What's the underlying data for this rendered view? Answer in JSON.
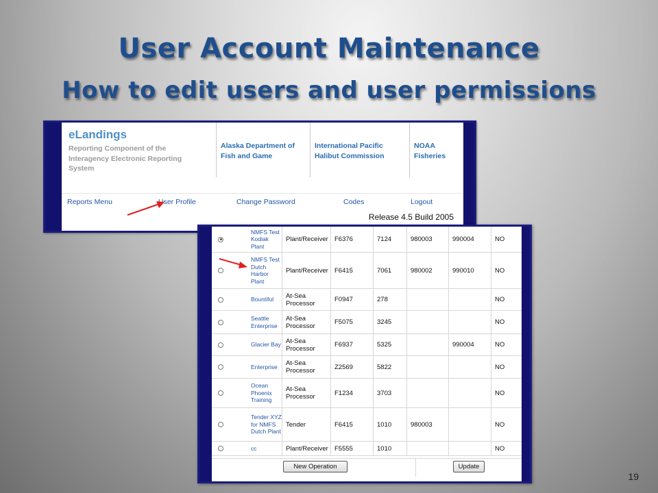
{
  "slide": {
    "title": "User Account Maintenance",
    "subtitle": "How to edit users and user permissions",
    "page_number": "19"
  },
  "elandings_header": {
    "app_name": "eLandings",
    "app_description": "Reporting Component of the Interagency Electronic Reporting System",
    "agencies": [
      "Alaska Department of Fish and Game",
      "International Pacific Halibut Commission",
      "NOAA Fisheries"
    ],
    "nav": [
      "Reports Menu",
      "User Profile",
      "Change Password",
      "Codes",
      "Logout"
    ],
    "release": "Release 4.5 Build 2005"
  },
  "operations_table": {
    "rows": [
      {
        "selected": true,
        "name": "NMFS Test Kodiak Plant",
        "type": "Plant/Receiver",
        "fed": "F6376",
        "code": "7124",
        "p1": "980003",
        "p2": "990004",
        "flag": "NO"
      },
      {
        "selected": false,
        "name": "NMFS Test Dutch Harbor Plant",
        "type": "Plant/Receiver",
        "fed": "F6415",
        "code": "7061",
        "p1": "980002",
        "p2": "990010",
        "flag": "NO"
      },
      {
        "selected": false,
        "name": "Bountiful",
        "type": "At-Sea Processor",
        "fed": "F0947",
        "code": "278",
        "p1": "",
        "p2": "",
        "flag": "NO"
      },
      {
        "selected": false,
        "name": "Seattle Enterprise",
        "type": "At-Sea Processor",
        "fed": "F5075",
        "code": "3245",
        "p1": "",
        "p2": "",
        "flag": "NO"
      },
      {
        "selected": false,
        "name": "Glacier Bay",
        "type": "At-Sea Processor",
        "fed": "F6937",
        "code": "5325",
        "p1": "",
        "p2": "990004",
        "flag": "NO"
      },
      {
        "selected": false,
        "name": "Enterprise",
        "type": "At-Sea Processor",
        "fed": "Z2569",
        "code": "5822",
        "p1": "",
        "p2": "",
        "flag": "NO"
      },
      {
        "selected": false,
        "name": "Ocean Phoenix Training",
        "type": "At-Sea Processor",
        "fed": "F1234",
        "code": "3703",
        "p1": "",
        "p2": "",
        "flag": "NO"
      },
      {
        "selected": false,
        "name": "Tender XYZ for NMFS Dutch Plant",
        "type": "Tender",
        "fed": "F6415",
        "code": "1010",
        "p1": "980003",
        "p2": "",
        "flag": "NO"
      },
      {
        "selected": false,
        "name": "cc",
        "type": "Plant/Receiver",
        "fed": "F5555",
        "code": "1010",
        "p1": "",
        "p2": "",
        "flag": "NO"
      }
    ],
    "new_operation_label": "New Operation",
    "update_label": "Update"
  },
  "colors": {
    "title": "#1f4e8c",
    "frame": "#12126e",
    "link": "#2255a4",
    "brand": "#4f8fc6",
    "arrow": "#e02020"
  }
}
